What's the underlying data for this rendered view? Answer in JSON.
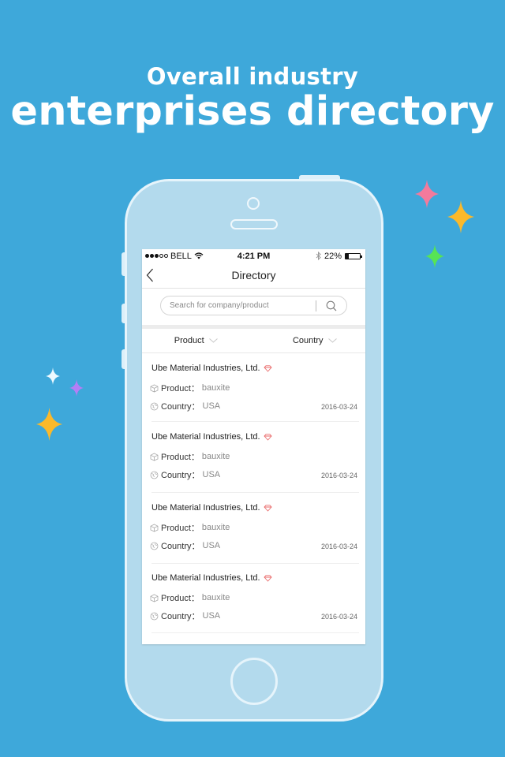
{
  "promo": {
    "line1": "Overall industry",
    "line2": "enterprises directory"
  },
  "colors": {
    "background": "#3ea8da",
    "phone_body": "#b3daed",
    "sparkle_pink": "#f37a9c",
    "sparkle_yellow": "#fbb92a",
    "sparkle_green": "#57e454",
    "sparkle_white": "#eefaff",
    "sparkle_purple": "#b47ef6",
    "diamond_red": "#e96a6a"
  },
  "statusbar": {
    "carrier": "BELL",
    "time": "4:21 PM",
    "battery": "22%",
    "battery_level": 0.22
  },
  "navbar": {
    "title": "Directory",
    "back_icon": "chevron-left-icon"
  },
  "search": {
    "placeholder": "Search for company/product",
    "icon": "search-icon"
  },
  "filters": [
    {
      "label": "Product",
      "icon": "chevron-down-icon"
    },
    {
      "label": "Country",
      "icon": "chevron-down-icon"
    }
  ],
  "list": [
    {
      "company": "Ube Material Industries, Ltd.",
      "product_label": "Product：",
      "product": "bauxite",
      "country_label": "Country：",
      "country": "USA",
      "date": "2016-03-24"
    },
    {
      "company": "Ube Material Industries, Ltd.",
      "product_label": "Product：",
      "product": "bauxite",
      "country_label": "Country：",
      "country": "USA",
      "date": "2016-03-24"
    },
    {
      "company": "Ube Material Industries, Ltd.",
      "product_label": "Product：",
      "product": "bauxite",
      "country_label": "Country：",
      "country": "USA",
      "date": "2016-03-24"
    },
    {
      "company": "Ube Material Industries, Ltd.",
      "product_label": "Product：",
      "product": "bauxite",
      "country_label": "Country：",
      "country": "USA",
      "date": "2016-03-24"
    }
  ]
}
